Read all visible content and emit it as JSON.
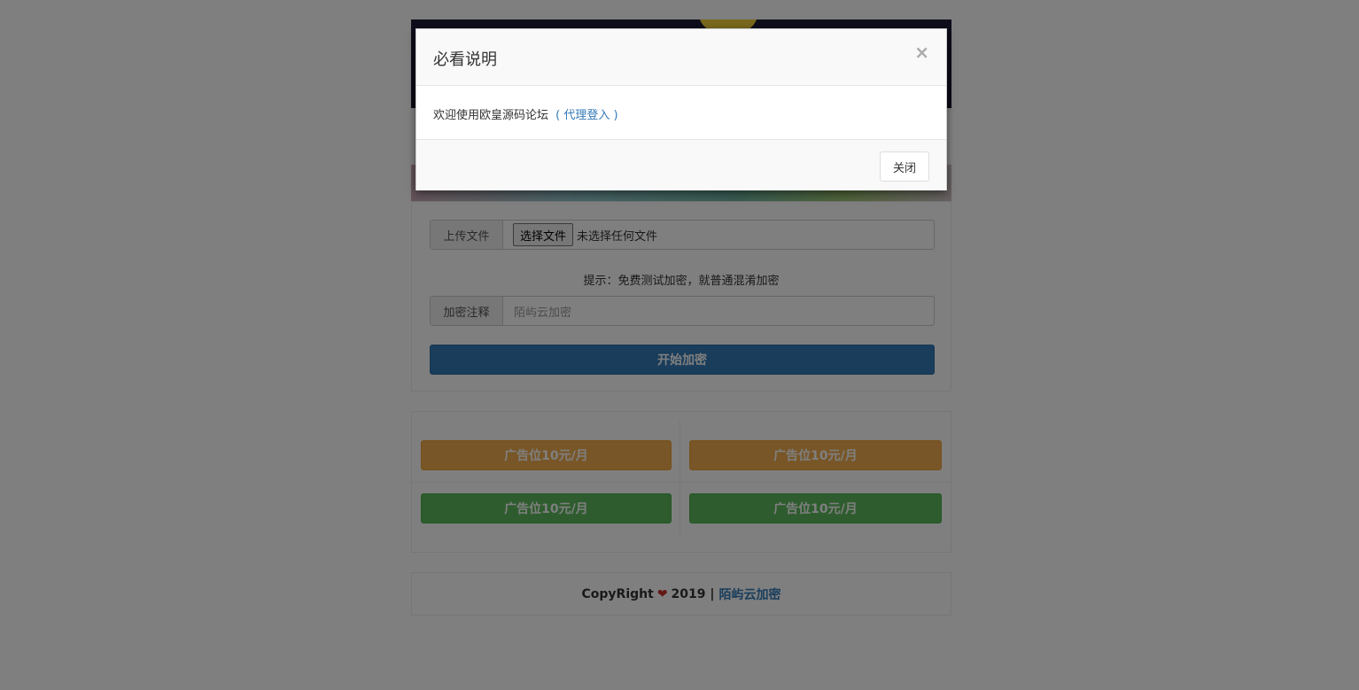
{
  "upload": {
    "label": "上传文件",
    "choose_button": "选择文件",
    "status": "未选择任何文件"
  },
  "hint": "提示：免费测试加密，就普通混淆加密",
  "comment": {
    "label": "加密注释",
    "placeholder": "陌屿云加密"
  },
  "start_button": "开始加密",
  "ads": [
    {
      "label": "广告位10元/月",
      "style": "warning"
    },
    {
      "label": "广告位10元/月",
      "style": "warning"
    },
    {
      "label": "广告位10元/月",
      "style": "success"
    },
    {
      "label": "广告位10元/月",
      "style": "success"
    }
  ],
  "footer": {
    "prefix": "CopyRight",
    "heart": "❤",
    "year": "2019 |",
    "link": "陌屿云加密"
  },
  "modal": {
    "title": "必看说明",
    "close_glyph": "×",
    "body_text": "欢迎使用欧皇源码论坛",
    "link_open": "(",
    "link_text": "代理登入",
    "link_close": ")",
    "close_button": "关闭"
  },
  "colors": {
    "primary": "#337ab7",
    "warning": "#f0ad4e",
    "success": "#5cb85c",
    "heart": "#c9302c"
  }
}
